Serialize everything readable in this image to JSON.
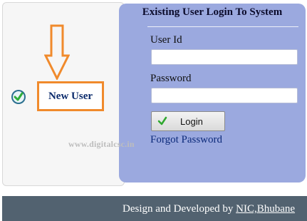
{
  "new_user": {
    "label": "New User"
  },
  "login_panel": {
    "title": "Existing User Login To System",
    "user_id_label": "User Id",
    "password_label": "Password",
    "user_id_value": "",
    "password_value": "",
    "login_button_label": "Login",
    "forgot_password_label": "Forgot Password"
  },
  "watermark": "www.digitalcsc.in",
  "footer": {
    "text": "Design and Developed by ",
    "link": "NIC,Bhubane"
  },
  "colors": {
    "panel_bg": "#9ba9df",
    "accent_orange": "#f08a2c",
    "footer_bg": "#526270",
    "link_blue": "#0c2a7a"
  },
  "icons": [
    "check-circle-icon",
    "down-arrow-icon",
    "check-icon"
  ]
}
